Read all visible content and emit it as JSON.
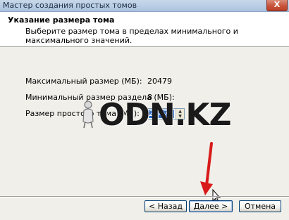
{
  "window": {
    "title": "Мастер создания простых томов",
    "close_label": "X"
  },
  "header": {
    "title": "Указание размера тома",
    "description": "Выберите размер тома в пределах минимального и максимального значений."
  },
  "fields": {
    "max_label": "Максимальный размер (МБ):",
    "max_value": "20479",
    "min_label": "Минимальный размер раздела (МБ):",
    "min_value": "8",
    "size_label": "Размер простого тома (МБ):",
    "size_value": "20479"
  },
  "watermark": {
    "text": "ODN.KZ"
  },
  "buttons": {
    "back": "< Назад",
    "next": "Далее >",
    "cancel": "Отмена"
  },
  "colors": {
    "annotation_arrow": "#d81a1a",
    "selection": "#316ac5"
  },
  "icons": {
    "close": "close-icon",
    "spin_up": "spin-up-icon",
    "spin_down": "spin-down-icon",
    "arrow": "annotation-arrow-icon",
    "cursor": "mouse-cursor-icon"
  }
}
